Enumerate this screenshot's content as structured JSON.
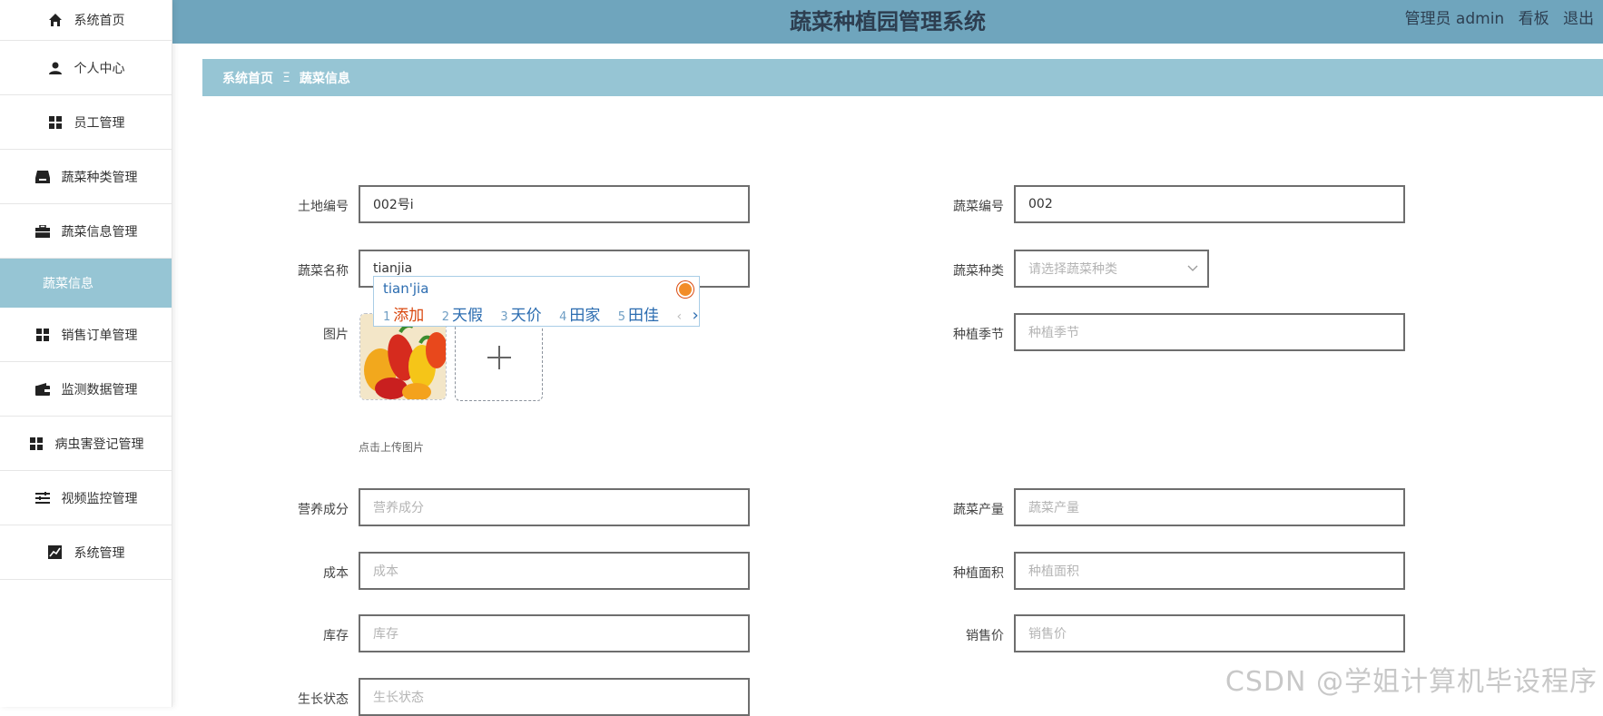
{
  "sidebar": {
    "items": [
      {
        "label": "系统首页",
        "icon": "home-icon"
      },
      {
        "label": "个人中心",
        "icon": "user-icon"
      },
      {
        "label": "员工管理",
        "icon": "grid-icon"
      },
      {
        "label": "蔬菜种类管理",
        "icon": "inbox-icon"
      },
      {
        "label": "蔬菜信息管理",
        "icon": "briefcase-icon"
      },
      {
        "label": "蔬菜信息",
        "icon": ""
      },
      {
        "label": "销售订单管理",
        "icon": "grid-icon"
      },
      {
        "label": "监测数据管理",
        "icon": "wallet-icon"
      },
      {
        "label": "病虫害登记管理",
        "icon": "grid-icon"
      },
      {
        "label": "视频监控管理",
        "icon": "list-icon"
      },
      {
        "label": "系统管理",
        "icon": "chart-icon"
      }
    ]
  },
  "header": {
    "title": "蔬菜种植园管理系统",
    "admin": "管理员 admin",
    "board": "看板",
    "logout": "退出"
  },
  "breadcrumb": {
    "home": "系统首页",
    "sep": "Ξ",
    "current": "蔬菜信息"
  },
  "form": {
    "land_no": {
      "label": "土地编号",
      "value": "002号i"
    },
    "veg_no": {
      "label": "蔬菜编号",
      "value": "002"
    },
    "veg_name": {
      "label": "蔬菜名称",
      "value": "tianjia"
    },
    "veg_type": {
      "label": "蔬菜种类",
      "placeholder": "请选择蔬菜种类"
    },
    "image": {
      "label": "图片",
      "hint": "点击上传图片"
    },
    "season": {
      "label": "种植季节",
      "placeholder": "种植季节"
    },
    "nutrition": {
      "label": "营养成分",
      "placeholder": "营养成分"
    },
    "yield": {
      "label": "蔬菜产量",
      "placeholder": "蔬菜产量"
    },
    "cost": {
      "label": "成本",
      "placeholder": "成本"
    },
    "area": {
      "label": "种植面积",
      "placeholder": "种植面积"
    },
    "stock": {
      "label": "库存",
      "placeholder": "库存"
    },
    "price": {
      "label": "销售价",
      "placeholder": "销售价"
    },
    "growth": {
      "label": "生长状态",
      "placeholder": "生长状态"
    }
  },
  "ime": {
    "pinyin": "tian'jia",
    "candidates": [
      {
        "n": "1",
        "text": "添加"
      },
      {
        "n": "2",
        "text": "天假"
      },
      {
        "n": "3",
        "text": "天价"
      },
      {
        "n": "4",
        "text": "田家"
      },
      {
        "n": "5",
        "text": "田佳"
      }
    ],
    "prev": "‹",
    "next": "›"
  },
  "watermark": "CSDN @学姐计算机毕设程序"
}
